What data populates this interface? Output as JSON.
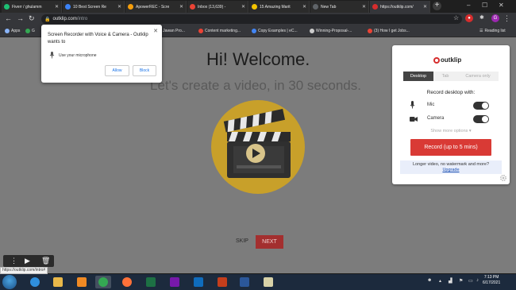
{
  "tabs": [
    {
      "title": "Fiverr / ghulamm",
      "color": "#1dbf73"
    },
    {
      "title": "10 Best Screen Re",
      "color": "#3b82f6"
    },
    {
      "title": "ApowerREC - Scre",
      "color": "#f59e0b"
    },
    {
      "title": "Inbox (13,639) - ",
      "color": "#ea4335"
    },
    {
      "title": "15 Amazing Marit",
      "color": "#f5c400"
    },
    {
      "title": "New Tab",
      "color": "#5f6368"
    },
    {
      "title": "https://outklip.com/",
      "color": "#d62d2d"
    }
  ],
  "address": {
    "host": "outklip.com",
    "path": "/intro"
  },
  "bookmarks": [
    {
      "label": "Apps",
      "color": "#8ab4f8"
    },
    {
      "label": "G",
      "color": "#34a853"
    },
    {
      "label": "b Jawan Pro...",
      "color": "#888"
    },
    {
      "label": "Content marketing...",
      "color": "#ea4335"
    },
    {
      "label": "Copy Examples | eC...",
      "color": "#4285f4"
    },
    {
      "label": "Winning-Proposal-...",
      "color": "#ccc"
    },
    {
      "label": "(3) How I get Jobs...",
      "color": "#ea4335"
    }
  ],
  "reading_list": "Reading list",
  "profile_initial": "G",
  "permission": {
    "title": "Screen Recorder with Voice & Camera - Outklip wants to",
    "item": "Use your microphone",
    "allow": "Allow",
    "block": "Block"
  },
  "page": {
    "heading": "Hi! Welcome.",
    "subheading": "Let's create a video, in 30 seconds.",
    "skip": "SKIP",
    "next": "NEXT"
  },
  "outklip": {
    "brand": "outklip",
    "tabs": [
      "Desktop",
      "Tab",
      "Camera only"
    ],
    "record_label": "Record desktop with:",
    "mic_label": "Mic",
    "camera_label": "Camera",
    "mic_on": true,
    "camera_on": true,
    "more_options": "Show more options ▾",
    "record_button": "Record (up to 5 mins)",
    "upsell_text": "Longer video, no watermark and more?",
    "upgrade_link": "Upgrade"
  },
  "status_url": "https://outklip.com/intro#",
  "taskbar": {
    "time": "7:13 PM",
    "date": "6/17/2021",
    "apps": [
      {
        "name": "ie",
        "color": "#2f8fdd"
      },
      {
        "name": "explorer",
        "color": "#e8b84a"
      },
      {
        "name": "media",
        "color": "#f08a24"
      },
      {
        "name": "chrome",
        "color": "#34a853"
      },
      {
        "name": "firefox",
        "color": "#ff7139"
      },
      {
        "name": "excel",
        "color": "#1d7044"
      },
      {
        "name": "onenote",
        "color": "#7719aa"
      },
      {
        "name": "outlook",
        "color": "#0f6cbd"
      },
      {
        "name": "powerpoint",
        "color": "#c43e1c"
      },
      {
        "name": "word",
        "color": "#2b579a"
      },
      {
        "name": "misc",
        "color": "#d8d2a8"
      }
    ]
  }
}
